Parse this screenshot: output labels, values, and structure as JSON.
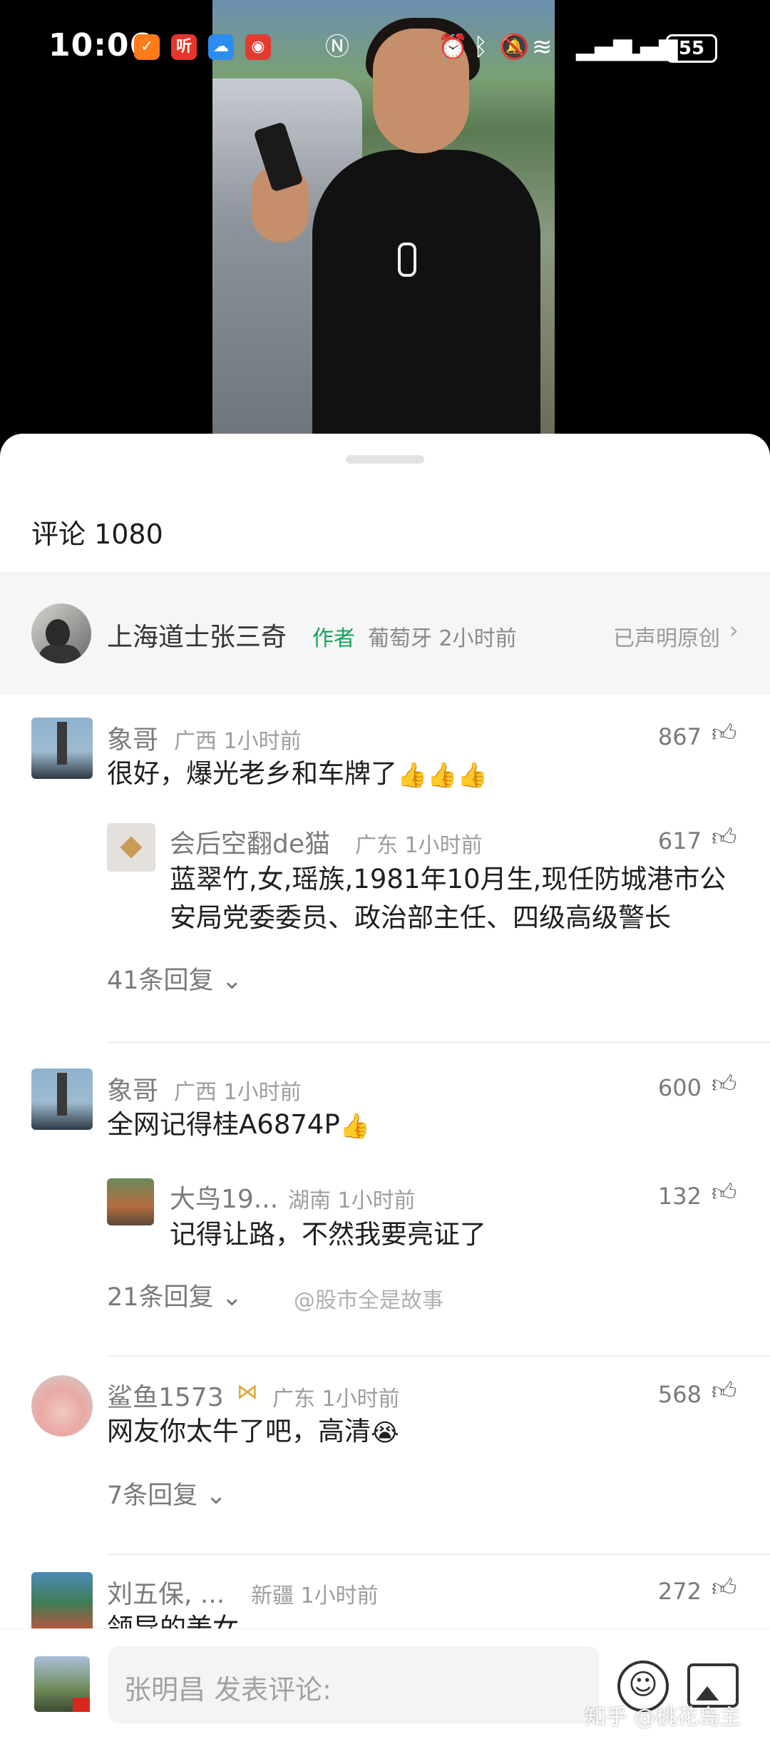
{
  "status_bar": {
    "time": "10:06",
    "app_icons": [
      "taobao-icon",
      "ting-icon",
      "weather-icon",
      "weibo-icon",
      "nfc-icon"
    ],
    "status_icons": [
      "alarm-icon",
      "bluetooth-icon",
      "mute-icon",
      "wifi-icon",
      "signal-icon",
      "signal-icon"
    ],
    "battery": "55",
    "ting_label": "听"
  },
  "sheet": {
    "title": "评论 1080"
  },
  "author": {
    "name": "上海道士张三奇",
    "tag": "作者",
    "meta": "葡萄牙 2小时前",
    "original": "已声明原创"
  },
  "comments": [
    {
      "user": "象哥",
      "meta": "广西 1小时前",
      "text": "很好，爆光老乡和车牌了",
      "emoji": "👍👍👍",
      "likes": "867",
      "reply": {
        "user": "会后空翻de猫",
        "meta": "广东 1小时前",
        "text": "蓝翠竹,女,瑶族,1981年10月生,现任防城港市公安局党委委员、政治部主任、四级高级警长",
        "likes": "617"
      },
      "replies_label": "41条回复"
    },
    {
      "user": "象哥",
      "meta": "广西 1小时前",
      "text": "全网记得桂A6874P",
      "emoji": "👍",
      "likes": "600",
      "reply": {
        "user": "大鸟19...",
        "meta": "湖南 1小时前",
        "text": "记得让路，不然我要亮证了",
        "likes": "132"
      },
      "replies_label": "21条回复"
    },
    {
      "user": "鲨鱼1573",
      "meta": "广东 1小时前",
      "text": "网友你太牛了吧，高清",
      "emoji": "😭",
      "likes": "568",
      "replies_label": "7条回复"
    },
    {
      "user": "刘五保, ...",
      "meta": "新疆 1小时前",
      "text": "领导的美女",
      "likes": "272"
    }
  ],
  "watermarks": {
    "middle": "@股市全是故事",
    "corner": "知乎 @桃花岛主"
  },
  "bottom_bar": {
    "input_placeholder": "张明昌 发表评论:"
  },
  "colors": {
    "author_tag": "#16a35b",
    "sheet_bg": "#ffffff",
    "author_bar_bg": "#f6f6f6"
  }
}
